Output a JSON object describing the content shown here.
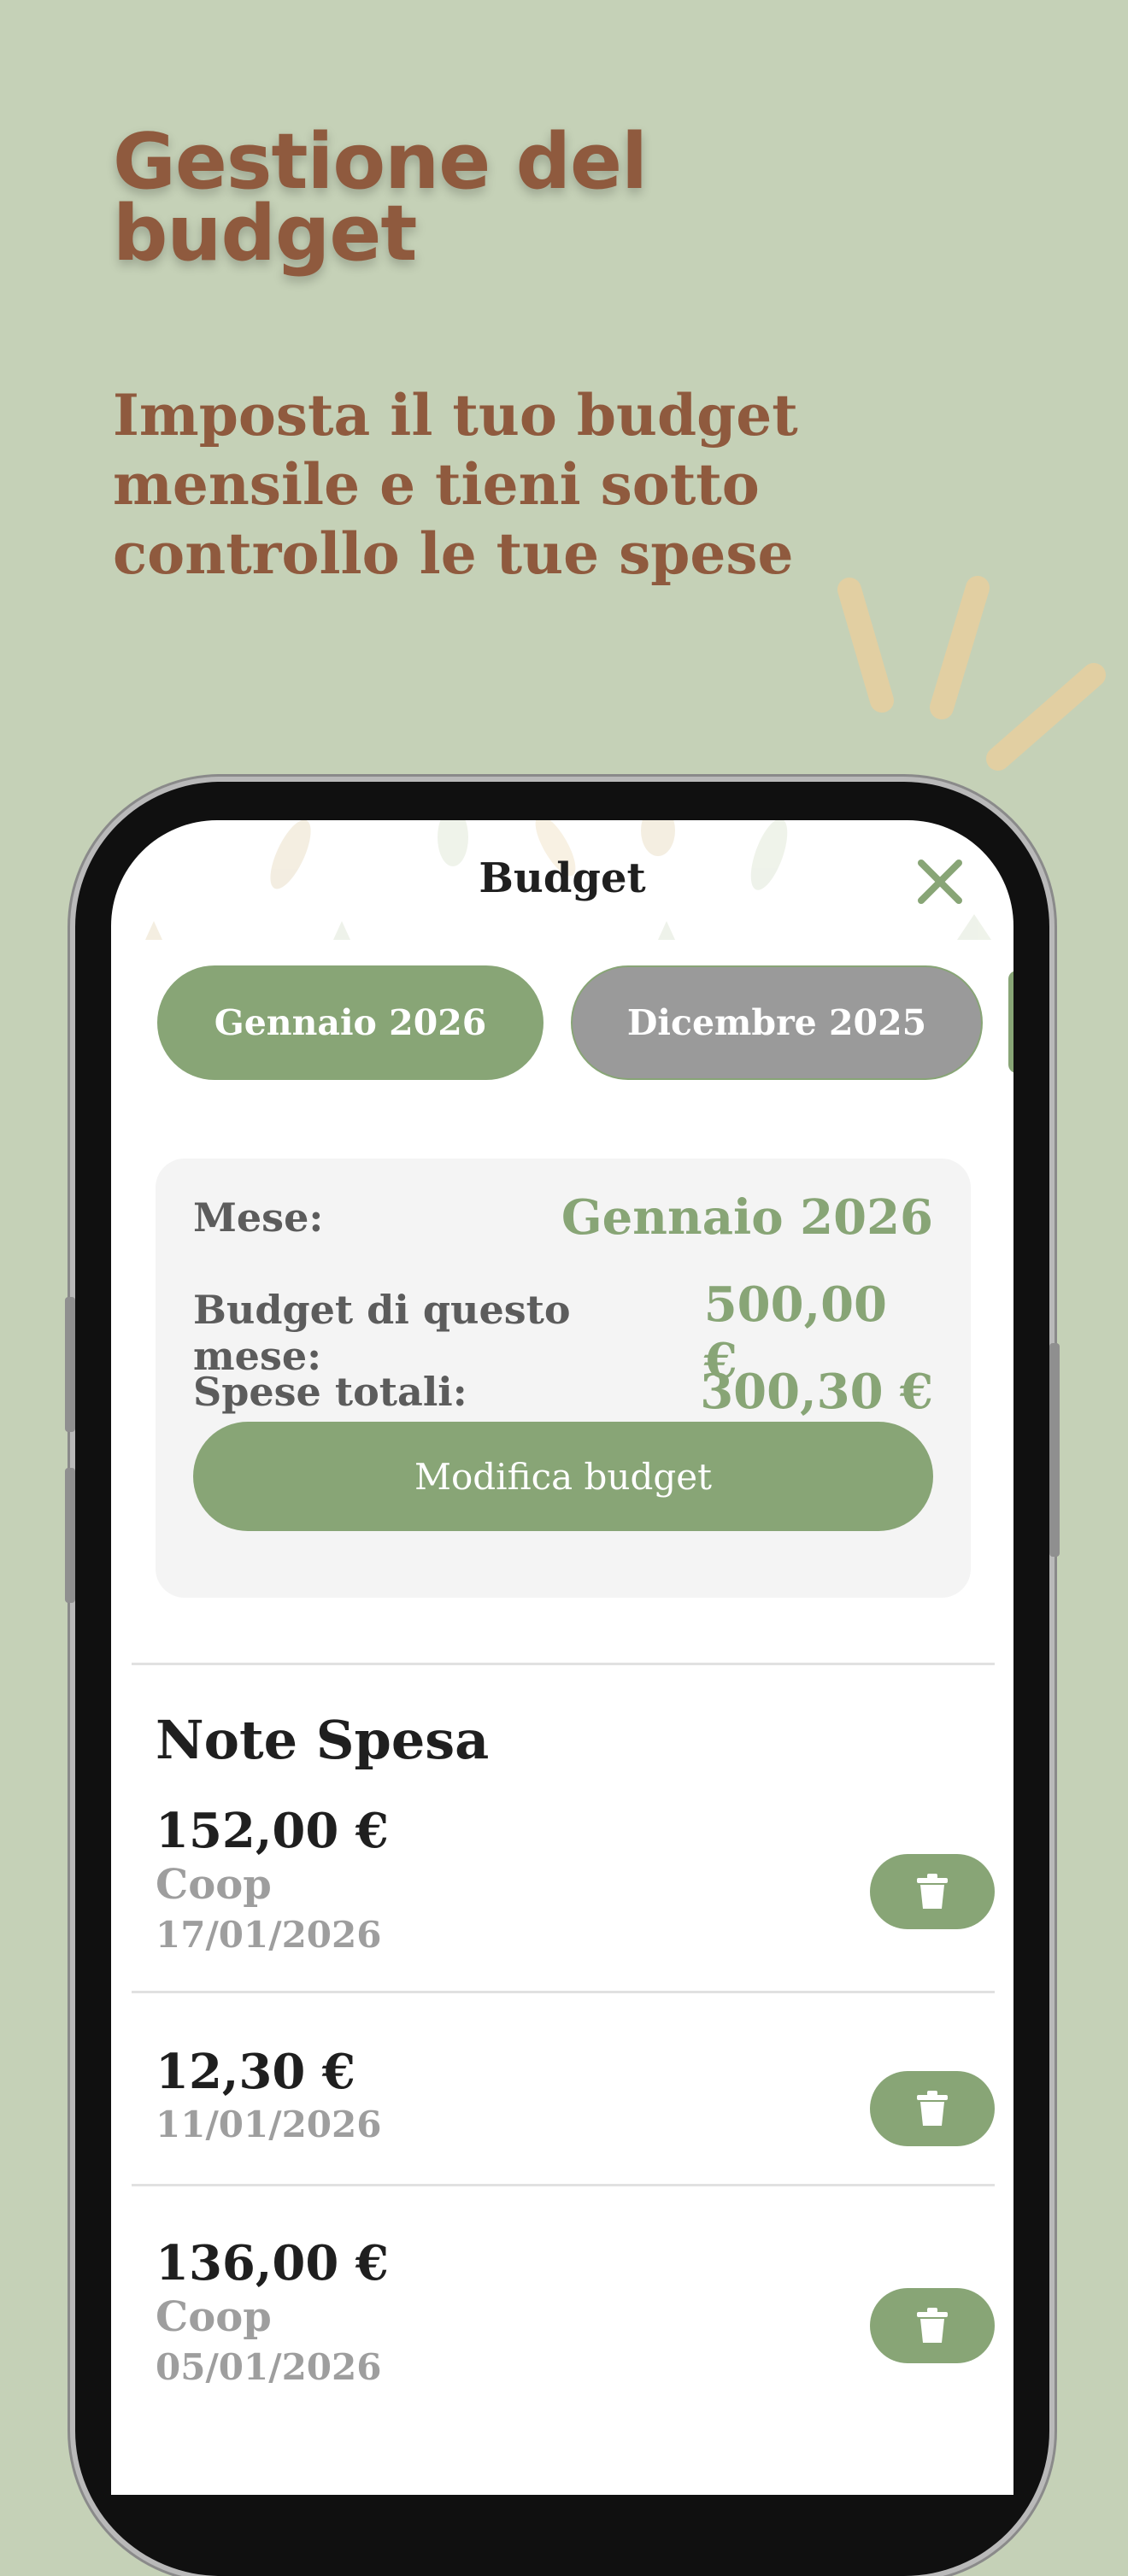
{
  "promo": {
    "headline_line1": "Gestione del",
    "headline_line2": "budget",
    "subline": "Imposta il tuo budget mensile e tieni sotto controllo le tue spese"
  },
  "colors": {
    "background": "#c5d1b7",
    "accent": "#88a576",
    "brown_text": "#8f5a3e",
    "inactive_pill": "#9a9a9a"
  },
  "screen": {
    "title": "Budget",
    "close_icon": "close-icon",
    "month_tabs": [
      {
        "label": "Gennaio 2026",
        "selected": true
      },
      {
        "label": "Dicembre 2025",
        "selected": false
      }
    ],
    "summary": {
      "month_label": "Mese:",
      "month_value": "Gennaio 2026",
      "budget_label": "Budget di questo mese:",
      "budget_value": "500,00 €",
      "spent_label": "Spese totali:",
      "spent_value": "300,30 €",
      "edit_button": "Modifica budget"
    },
    "expenses_title": "Note Spesa",
    "expenses": [
      {
        "amount": "152,00 €",
        "store": "Coop",
        "date": "17/01/2026"
      },
      {
        "amount": "12,30 €",
        "store": "",
        "date": "11/01/2026"
      },
      {
        "amount": "136,00 €",
        "store": "Coop",
        "date": "05/01/2026"
      }
    ],
    "delete_icon": "trash-icon"
  }
}
